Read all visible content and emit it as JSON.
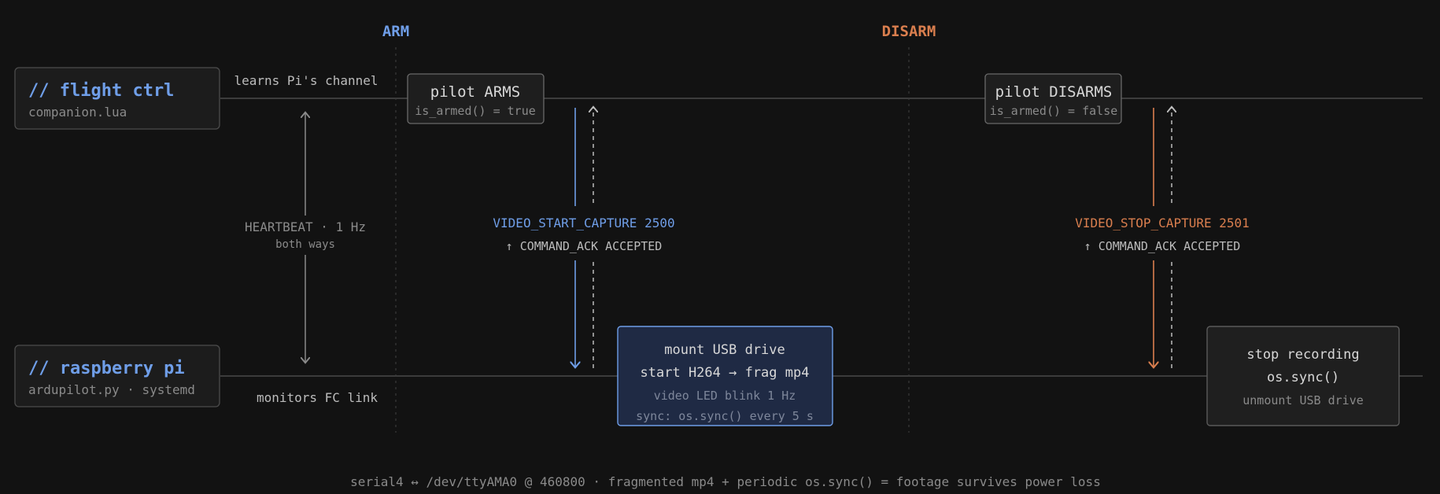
{
  "colors": {
    "background": "#121212",
    "arm": "#6f9ee8",
    "disarm": "#d97e4e",
    "text": "#d2d2d2",
    "muted": "#8a8a8a",
    "node_fill": "#1e1e1e",
    "node_border": "#4c4c4c",
    "usb_fill": "#1f2a44",
    "usb_border": "#6f9ee8"
  },
  "phases": {
    "arm": "ARM",
    "disarm": "DISARM"
  },
  "lanes": {
    "fc": {
      "title": "// flight ctrl",
      "subtitle": "companion.lua",
      "note": "learns Pi's channel"
    },
    "pi": {
      "title": "// raspberry pi",
      "subtitle": "ardupilot.py · systemd",
      "note": "monitors FC link"
    }
  },
  "heartbeat": {
    "label": "HEARTBEAT · 1 Hz",
    "sublabel": "both ways"
  },
  "events": {
    "pilot_arms": {
      "title": "pilot ARMS",
      "detail": "is_armed() = true"
    },
    "pilot_disarms": {
      "title": "pilot DISARMS",
      "detail": "is_armed() = false"
    }
  },
  "commands": {
    "start": {
      "name": "VIDEO_START_CAPTURE 2500",
      "ack": "↑ COMMAND_ACK ACCEPTED"
    },
    "stop": {
      "name": "VIDEO_STOP_CAPTURE 2501",
      "ack": "↑ COMMAND_ACK ACCEPTED"
    }
  },
  "actions": {
    "start": {
      "line1": "mount USB drive",
      "line2": "start H264 → frag mp4",
      "line3": "video LED blink 1 Hz",
      "line4": "sync: os.sync() every 5 s"
    },
    "stop": {
      "line1": "stop recording",
      "line2": "os.sync()",
      "line3": "unmount USB drive"
    }
  },
  "footer": "serial4 ↔ /dev/ttyAMA0 @ 460800 · fragmented mp4 + periodic os.sync() = footage survives power loss"
}
